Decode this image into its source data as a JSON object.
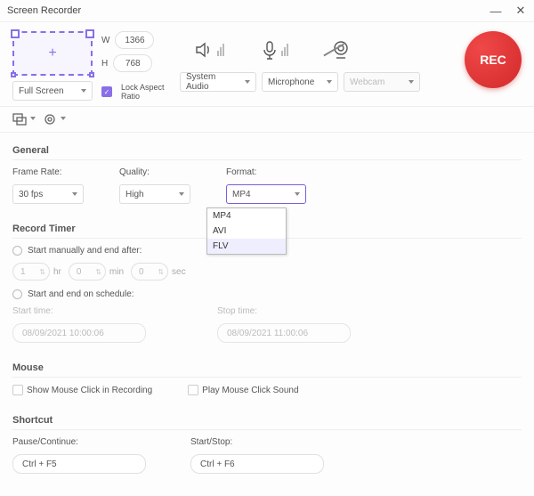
{
  "title": "Screen Recorder",
  "capture": {
    "width": "1366",
    "height": "768",
    "mode": "Full Screen",
    "lock_aspect": "Lock Aspect Ratio",
    "w_label": "W",
    "h_label": "H"
  },
  "audio_sources": {
    "system": "System Audio",
    "mic": "Microphone",
    "webcam": "Webcam"
  },
  "rec_label": "REC",
  "general": {
    "title": "General",
    "frame_rate_label": "Frame Rate:",
    "frame_rate_value": "30 fps",
    "quality_label": "Quality:",
    "quality_value": "High",
    "format_label": "Format:",
    "format_value": "MP4",
    "format_options": [
      "MP4",
      "AVI",
      "FLV"
    ]
  },
  "timer": {
    "title": "Record Timer",
    "manual_label": "Start manually and end after:",
    "hr_val": "1",
    "hr_unit": "hr",
    "min_val": "0",
    "min_unit": "min",
    "sec_val": "0",
    "sec_unit": "sec",
    "schedule_label": "Start and end on schedule:",
    "start_label": "Start time:",
    "start_value": "08/09/2021 10:00:06",
    "stop_label": "Stop time:",
    "stop_value": "08/09/2021 11:00:06"
  },
  "mouse": {
    "title": "Mouse",
    "show_click": "Show Mouse Click in Recording",
    "play_sound": "Play Mouse Click Sound"
  },
  "shortcut": {
    "title": "Shortcut",
    "pause_label": "Pause/Continue:",
    "pause_value": "Ctrl + F5",
    "start_label": "Start/Stop:",
    "start_value": "Ctrl + F6"
  }
}
